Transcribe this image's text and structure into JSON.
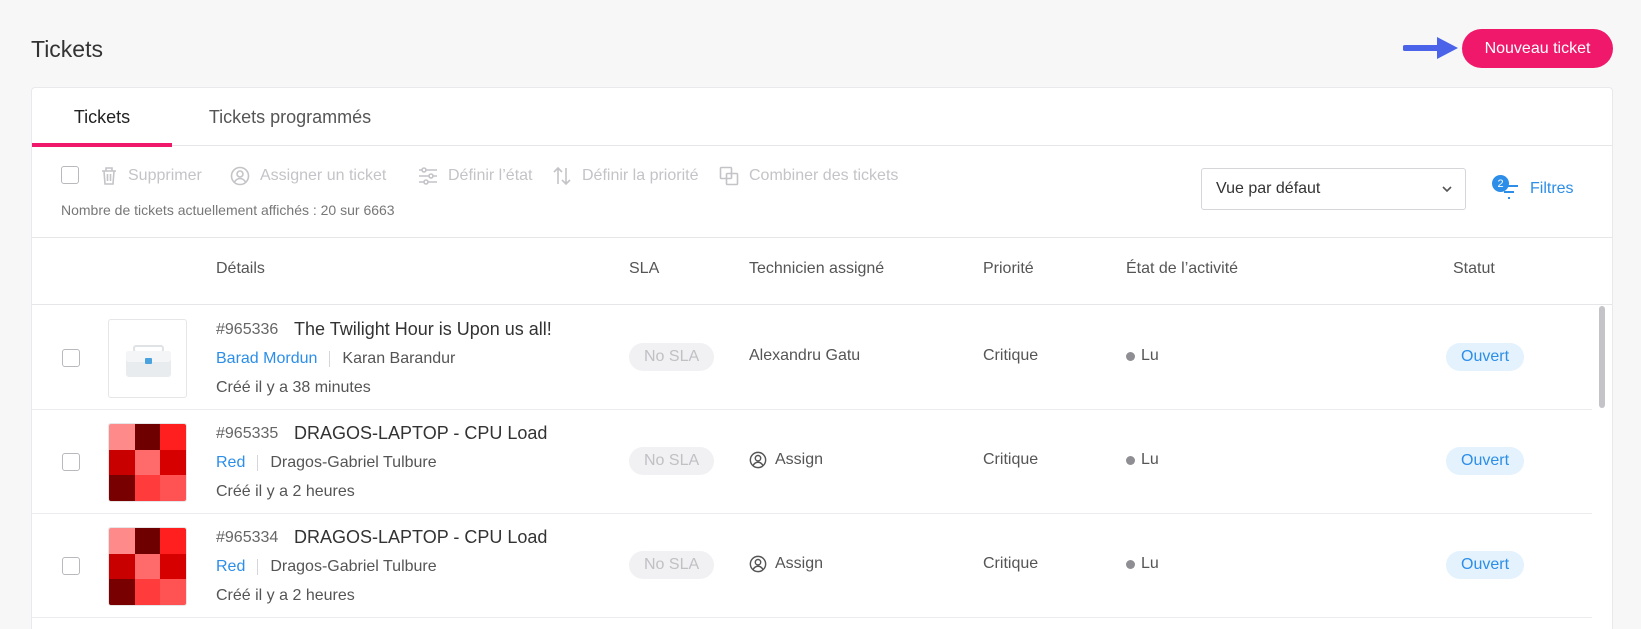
{
  "page": {
    "title": "Tickets",
    "new_ticket_label": "Nouveau ticket",
    "accent": "#f0186b"
  },
  "tabs": [
    {
      "label": "Tickets",
      "active": true
    },
    {
      "label": "Tickets programmés",
      "active": false
    }
  ],
  "toolbar": {
    "actions": [
      {
        "label": "Supprimer",
        "icon": "trash-icon"
      },
      {
        "label": "Assigner un ticket",
        "icon": "user-circle-icon"
      },
      {
        "label": "Définir l’état",
        "icon": "sliders-icon"
      },
      {
        "label": "Définir la priorité",
        "icon": "sort-arrows-icon"
      },
      {
        "label": "Combiner des tickets",
        "icon": "merge-icon"
      }
    ],
    "count_text": "Nombre de tickets actuellement affichés : 20 sur 6663",
    "view_select": "Vue par défaut",
    "filters_label": "Filtres",
    "filters_count": "2"
  },
  "columns": {
    "details": "Détails",
    "sla": "SLA",
    "technician": "Technicien assigné",
    "priority": "Priorité",
    "activity": "État de l’activité",
    "status": "Statut"
  },
  "tickets": [
    {
      "id": "#965336",
      "title": "The Twilight Hour is Upon us all!",
      "org": "Barad Mordun",
      "person": "Karan Barandur",
      "created": "Créé il y a 38 minutes",
      "sla": "No SLA",
      "technician": "Alexandru Gatu",
      "priority": "Critique",
      "activity": "Lu",
      "status": "Ouvert",
      "thumb": "toolbox-icon"
    },
    {
      "id": "#965335",
      "title": "DRAGOS-LAPTOP - CPU Load",
      "org": "Red",
      "person": "Dragos-Gabriel Tulbure",
      "created": "Créé il y a 2 heures",
      "sla": "No SLA",
      "technician": "Assign",
      "priority": "Critique",
      "activity": "Lu",
      "status": "Ouvert",
      "thumb": "red-identicon"
    },
    {
      "id": "#965334",
      "title": "DRAGOS-LAPTOP - CPU Load",
      "org": "Red",
      "person": "Dragos-Gabriel Tulbure",
      "created": "Créé il y a 2 heures",
      "sla": "No SLA",
      "technician": "Assign",
      "priority": "Critique",
      "activity": "Lu",
      "status": "Ouvert",
      "thumb": "red-identicon"
    }
  ]
}
